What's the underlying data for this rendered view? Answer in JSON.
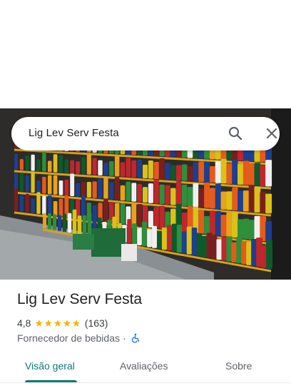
{
  "search": {
    "query": "Lig Lev Serv Festa",
    "search_icon": "search-icon",
    "close_icon": "close-icon"
  },
  "photo": {
    "subject": "store-shelves-photo"
  },
  "place": {
    "name": "Lig Lev Serv Festa",
    "rating": "4,8",
    "stars": 5,
    "review_count": "(163)",
    "category": "Fornecedor de bebidas",
    "separator": "·",
    "accessibility_icon": "wheelchair-accessible-icon"
  },
  "tabs": [
    {
      "label": "Visão geral",
      "active": true
    },
    {
      "label": "Avaliações",
      "active": false
    },
    {
      "label": "Sobre",
      "active": false
    }
  ],
  "colors": {
    "accent": "#0b7a75",
    "star": "#f4b400",
    "access_icon": "#1a73e8"
  }
}
